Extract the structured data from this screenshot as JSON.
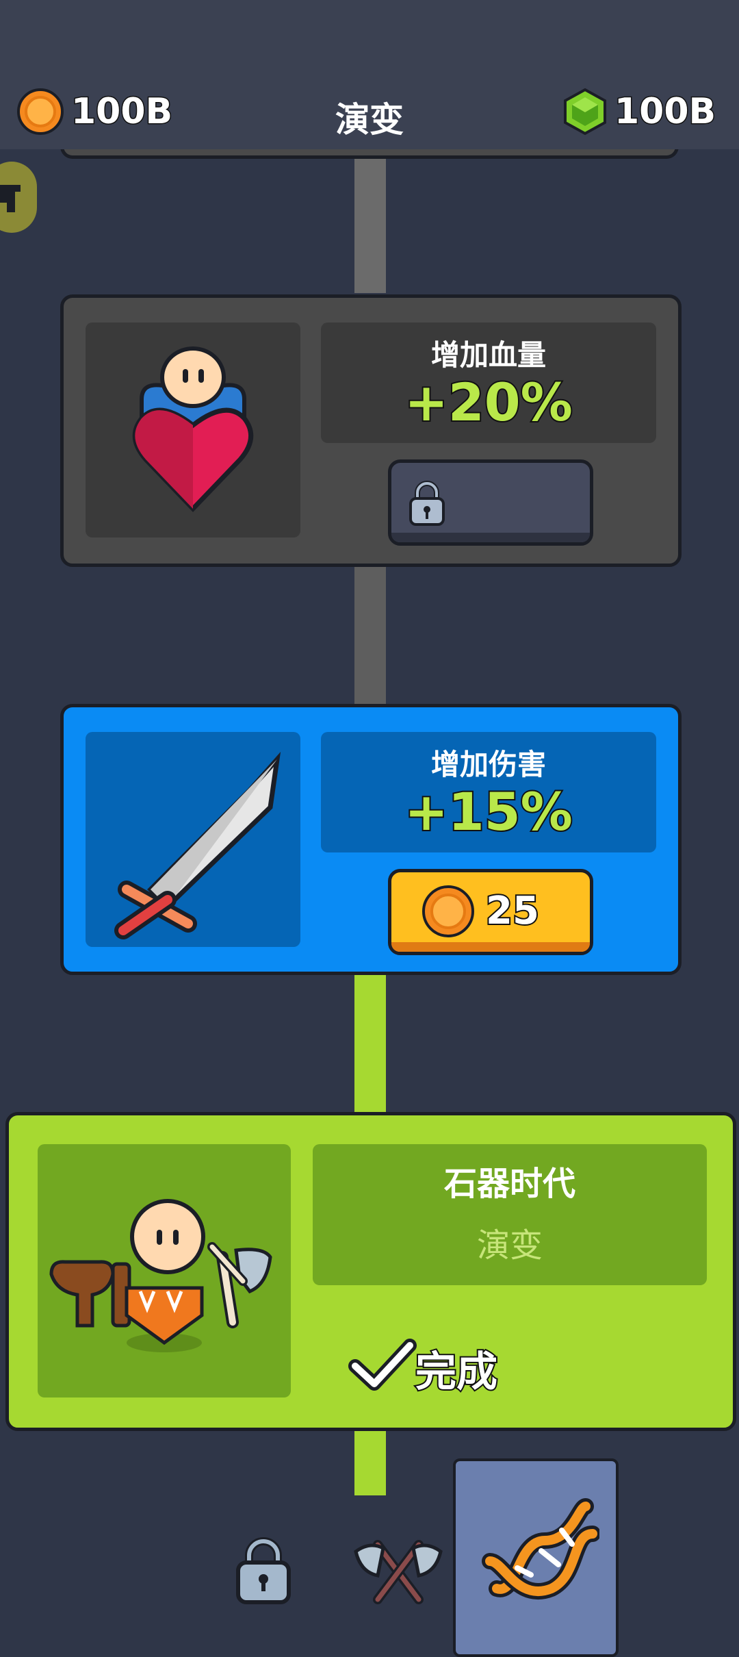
{
  "header": {
    "title": "演变",
    "coins": {
      "amount": "100B",
      "icon": "coin-icon"
    },
    "gems": {
      "amount": "100B",
      "icon": "green-gem-icon"
    }
  },
  "cards": [
    {
      "icon": "heart-character-icon",
      "label": "增加血量",
      "value": "+20%",
      "state": "locked",
      "button_icon": "lock-icon"
    },
    {
      "icon": "sword-icon",
      "label": "增加伤害",
      "value": "+15%",
      "state": "purchasable",
      "cost": "25",
      "button_icon": "coin-icon"
    },
    {
      "icon": "caveman-icon",
      "label": "石器时代",
      "subtitle": "演变",
      "state": "completed",
      "status": "完成",
      "status_icon": "checkmark-icon"
    }
  ],
  "bottom_nav": {
    "items": [
      {
        "icon": "lock-icon"
      },
      {
        "icon": "crossed-axes-icon"
      },
      {
        "icon": "dna-icon",
        "selected": true
      }
    ]
  },
  "colors": {
    "background": "#2f3648",
    "header": "#3b4152",
    "locked_card": "#4a4a4a",
    "active_card": "#0a8bf4",
    "completed_card": "#a6d931",
    "accent_value": "#b9e84a",
    "buy_button": "#ffbf1f"
  }
}
